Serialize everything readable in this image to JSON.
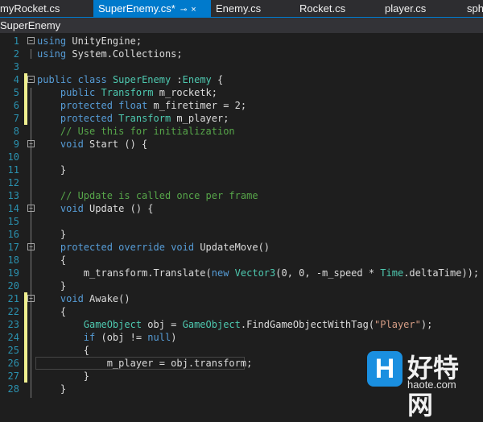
{
  "tabs": [
    {
      "label": "myRocket.cs",
      "active": false
    },
    {
      "label": "SuperEnemy.cs*",
      "active": true
    },
    {
      "label": "Enemy.cs",
      "active": false
    },
    {
      "label": "Rocket.cs",
      "active": false
    },
    {
      "label": "player.cs",
      "active": false
    },
    {
      "label": "sphe",
      "active": false
    }
  ],
  "tab_pin_icon": "⊸",
  "tab_close_icon": "×",
  "nav_class": "SuperEnemy",
  "colors": {
    "accent": "#007acc",
    "editor_bg": "#1e1e1e",
    "line_number": "#2b91af",
    "keyword": "#569cd6",
    "type": "#4ec9b0",
    "comment": "#57a64a",
    "string": "#d69d85",
    "change_bar": "#efef8f"
  },
  "watermark": {
    "logo": "H",
    "title": "好特网",
    "url": "haote.com"
  },
  "code_lines": [
    {
      "n": "1",
      "fold": true,
      "changed": false,
      "tokens": [
        {
          "t": "using",
          "c": "kw"
        },
        {
          "t": " UnityEngine;"
        }
      ]
    },
    {
      "n": "2",
      "fold": false,
      "changed": false,
      "tokens": [
        {
          "t": "using",
          "c": "kw"
        },
        {
          "t": " System.Collections;"
        }
      ]
    },
    {
      "n": "3",
      "fold": false,
      "changed": false,
      "tokens": []
    },
    {
      "n": "4",
      "fold": true,
      "changed": true,
      "tokens": [
        {
          "t": "public",
          "c": "kw"
        },
        {
          "t": " "
        },
        {
          "t": "class",
          "c": "kw"
        },
        {
          "t": " "
        },
        {
          "t": "SuperEnemy",
          "c": "ty"
        },
        {
          "t": " :"
        },
        {
          "t": "Enemy",
          "c": "ty"
        },
        {
          "t": " {"
        }
      ]
    },
    {
      "n": "5",
      "fold": false,
      "changed": true,
      "tokens": [
        {
          "t": "    "
        },
        {
          "t": "public",
          "c": "kw"
        },
        {
          "t": " "
        },
        {
          "t": "Transform",
          "c": "ty"
        },
        {
          "t": " m_rocketk;"
        }
      ]
    },
    {
      "n": "6",
      "fold": false,
      "changed": true,
      "tokens": [
        {
          "t": "    "
        },
        {
          "t": "protected",
          "c": "kw"
        },
        {
          "t": " "
        },
        {
          "t": "float",
          "c": "kw"
        },
        {
          "t": " m_firetimer = 2;"
        }
      ]
    },
    {
      "n": "7",
      "fold": false,
      "changed": true,
      "tokens": [
        {
          "t": "    "
        },
        {
          "t": "protected",
          "c": "kw"
        },
        {
          "t": " "
        },
        {
          "t": "Transform",
          "c": "ty"
        },
        {
          "t": " m_player;"
        }
      ]
    },
    {
      "n": "8",
      "fold": false,
      "changed": false,
      "tokens": [
        {
          "t": "    "
        },
        {
          "t": "// Use this for initialization",
          "c": "cm"
        }
      ]
    },
    {
      "n": "9",
      "fold": true,
      "changed": false,
      "tokens": [
        {
          "t": "    "
        },
        {
          "t": "void",
          "c": "kw"
        },
        {
          "t": " Start () {"
        }
      ]
    },
    {
      "n": "10",
      "fold": false,
      "changed": false,
      "tokens": []
    },
    {
      "n": "11",
      "fold": false,
      "changed": false,
      "tokens": [
        {
          "t": "    }"
        }
      ]
    },
    {
      "n": "12",
      "fold": false,
      "changed": false,
      "tokens": []
    },
    {
      "n": "13",
      "fold": false,
      "changed": false,
      "tokens": [
        {
          "t": "    "
        },
        {
          "t": "// Update is called once per frame",
          "c": "cm"
        }
      ]
    },
    {
      "n": "14",
      "fold": true,
      "changed": false,
      "tokens": [
        {
          "t": "    "
        },
        {
          "t": "void",
          "c": "kw"
        },
        {
          "t": " Update () {"
        }
      ]
    },
    {
      "n": "15",
      "fold": false,
      "changed": false,
      "tokens": []
    },
    {
      "n": "16",
      "fold": false,
      "changed": false,
      "tokens": [
        {
          "t": "    }"
        }
      ]
    },
    {
      "n": "17",
      "fold": true,
      "changed": false,
      "tokens": [
        {
          "t": "    "
        },
        {
          "t": "protected",
          "c": "kw"
        },
        {
          "t": " "
        },
        {
          "t": "override",
          "c": "kw"
        },
        {
          "t": " "
        },
        {
          "t": "void",
          "c": "kw"
        },
        {
          "t": " UpdateMove()"
        }
      ]
    },
    {
      "n": "18",
      "fold": false,
      "changed": false,
      "tokens": [
        {
          "t": "    {"
        }
      ]
    },
    {
      "n": "19",
      "fold": false,
      "changed": false,
      "tokens": [
        {
          "t": "        m_transform.Translate("
        },
        {
          "t": "new",
          "c": "kw"
        },
        {
          "t": " "
        },
        {
          "t": "Vector3",
          "c": "ty"
        },
        {
          "t": "(0, 0, -m_speed * "
        },
        {
          "t": "Time",
          "c": "ty"
        },
        {
          "t": ".deltaTime));"
        }
      ]
    },
    {
      "n": "20",
      "fold": false,
      "changed": false,
      "tokens": [
        {
          "t": "    }"
        }
      ]
    },
    {
      "n": "21",
      "fold": true,
      "changed": true,
      "tokens": [
        {
          "t": "    "
        },
        {
          "t": "void",
          "c": "kw"
        },
        {
          "t": " Awake()"
        }
      ]
    },
    {
      "n": "22",
      "fold": false,
      "changed": true,
      "tokens": [
        {
          "t": "    {"
        }
      ]
    },
    {
      "n": "23",
      "fold": false,
      "changed": true,
      "tokens": [
        {
          "t": "        "
        },
        {
          "t": "GameObject",
          "c": "ty"
        },
        {
          "t": " obj = "
        },
        {
          "t": "GameObject",
          "c": "ty"
        },
        {
          "t": ".FindGameObjectWithTag("
        },
        {
          "t": "\"Player\"",
          "c": "st"
        },
        {
          "t": ");"
        }
      ]
    },
    {
      "n": "24",
      "fold": false,
      "changed": true,
      "tokens": [
        {
          "t": "        "
        },
        {
          "t": "if",
          "c": "kw"
        },
        {
          "t": " (obj != "
        },
        {
          "t": "null",
          "c": "kw"
        },
        {
          "t": ")"
        }
      ]
    },
    {
      "n": "25",
      "fold": false,
      "changed": true,
      "tokens": [
        {
          "t": "        {"
        }
      ]
    },
    {
      "n": "26",
      "fold": false,
      "changed": true,
      "current": true,
      "tokens": [
        {
          "t": "            m_player = obj.transform;"
        }
      ]
    },
    {
      "n": "27",
      "fold": false,
      "changed": true,
      "tokens": [
        {
          "t": "        }"
        }
      ]
    },
    {
      "n": "28",
      "fold": false,
      "changed": false,
      "tokens": [
        {
          "t": "    }"
        }
      ]
    }
  ]
}
